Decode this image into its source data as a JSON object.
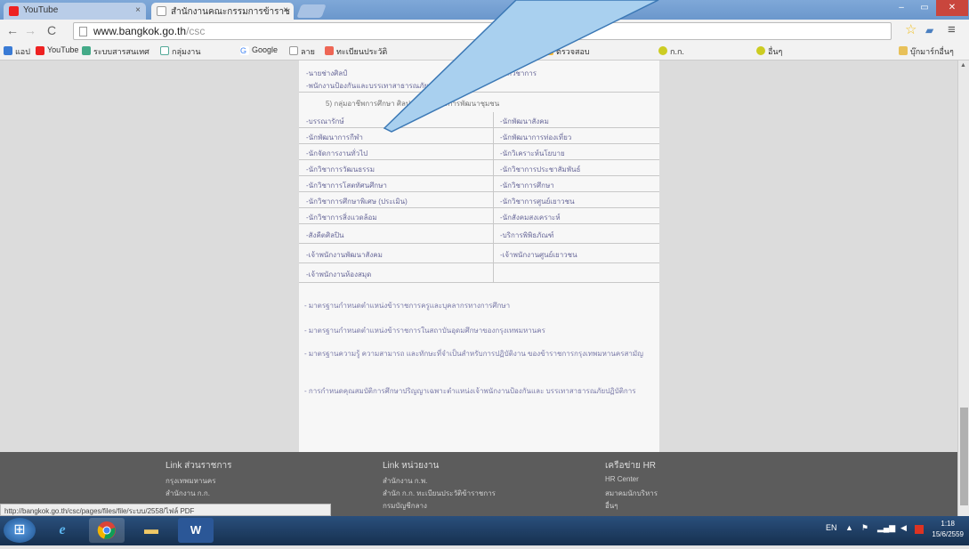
{
  "tabs": [
    {
      "label": "YouTube"
    },
    {
      "label": "สำนักงานคณะกรรมการข้าราช"
    }
  ],
  "omnibox": {
    "host": "www.bangkok.go.th",
    "path": "/csc"
  },
  "bookmarks": [
    {
      "label": "แอป"
    },
    {
      "label": "YouTube"
    },
    {
      "label": "ระบบสารสนเทศ"
    },
    {
      "label": "กลุ่มงาน"
    },
    {
      "label": "Google"
    },
    {
      "label": "ลาย"
    },
    {
      "label": "ทะเบียนประวัติ"
    },
    {
      "label": "ระบบ"
    },
    {
      "label": "ตรวจสอบ"
    },
    {
      "label": "ก.ก."
    },
    {
      "label": "อื่นๆ"
    },
    {
      "label": "บุ๊กมาร์กอื่นๆ"
    }
  ],
  "grid": {
    "top_rows": [
      {
        "left": "-นายช่างศิลป์",
        "right": "-นักวิชาการ"
      },
      {
        "left": "-พนักงานป้องกันและบรรเทาสาธารณภัย",
        "right": ""
      }
    ],
    "note": "5) กลุ่มอาชีพการศึกษา ศิลปะ สังคม และการพัฒนาชุมชน",
    "rows": [
      {
        "left": "-บรรณารักษ์",
        "right": "-นักพัฒนาสังคม"
      },
      {
        "left": "-นักพัฒนาการกีฬา",
        "right": "-นักพัฒนาการท่องเที่ยว"
      },
      {
        "left": "-นักจัดการงานทั่วไป",
        "right": "-นักวิเคราะห์นโยบาย"
      },
      {
        "left": "-นักวิชาการวัฒนธรรม",
        "right": "-นักวิชาการประชาสัมพันธ์"
      },
      {
        "left": "-นักวิชาการโสตทัศนศึกษา",
        "right": "-นักวิชาการศึกษา"
      },
      {
        "left": "-นักวิชาการศึกษาพิเศษ (ประเมิน)",
        "right": "-นักวิชาการศูนย์เยาวชน"
      },
      {
        "left": "-นักวิชาการสิ่งแวดล้อม",
        "right": "-นักสังคมสงเคราะห์"
      },
      {
        "left": "-สังคีตศิลปิน",
        "right": "-บริการพิพิธภัณฑ์"
      },
      {
        "left": "-เจ้าพนักงานพัฒนาสังคม",
        "right": "-เจ้าพนักงานศูนย์เยาวชน"
      },
      {
        "left": "-เจ้าพนักงานห้องสมุด",
        "right": ""
      }
    ]
  },
  "bullets": [
    {
      "text": "- มาตรฐานกำหนดตำแหน่งข้าราชการครูและบุคลากรทางการศึกษา"
    },
    {
      "text": "- มาตรฐานกำหนดตำแหน่งข้าราชการในสถาบันอุดมศึกษาของกรุงเทพมหานคร"
    },
    {
      "text": "- มาตรฐานความรู้ ความสามารถ และทักษะที่จำเป็นสำหรับการปฏิบัติงาน ของข้าราชการกรุงเทพมหานครสามัญ"
    },
    {
      "text": "- การกำหนดคุณสมบัติการศึกษาปริญญาเฉพาะตำแหน่งเจ้าพนักงานป้องกันและ บรรเทาสาธารณภัยปฏิบัติการ"
    }
  ],
  "footer": {
    "col1": {
      "title": "Link ส่วนราชการ",
      "items": [
        "กรุงเทพมหานคร",
        "สำนักงาน ก.ก."
      ]
    },
    "col2": {
      "title": "Link หน่วยงาน",
      "items": [
        "สำนักงาน ก.พ.",
        "สำนัก ก.ก. ทะเบียนประวัติข้าราชการ",
        "กรมบัญชีกลาง"
      ]
    },
    "col3": {
      "title": "เครือข่าย HR",
      "items": [
        "HR Center",
        "สมาคมนักบริหาร",
        "อื่นๆ"
      ]
    }
  },
  "status_url": "http://bangkok.go.th/csc/pages/files/file/ระบบ/2558/ไฟล์ PDF",
  "tray": {
    "lang": "EN",
    "time": "1:18",
    "date": "15/6/2559"
  },
  "colors": {
    "page_bg": "#dcdcdc",
    "content_bg": "#f7f7f7",
    "footer_bg": "#5c5c5c",
    "callout": "#a9d0ef"
  }
}
